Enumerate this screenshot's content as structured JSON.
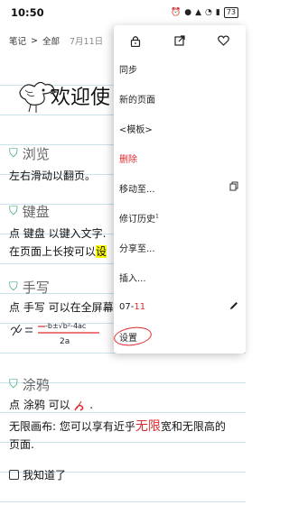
{
  "status": {
    "time": "10:50",
    "battery": "73"
  },
  "breadcrumb": {
    "notes": "笔记",
    "sep": ">",
    "all": "全部",
    "date": "7月11日"
  },
  "welcome": "欢迎使",
  "sections": {
    "browse": {
      "heading": "浏览",
      "line1": "左右滑动以翻页。"
    },
    "keyboard": {
      "heading": "键盘",
      "line1": "点 键盘 以键入文字.",
      "line2_a": "在页面上长按可以",
      "line2_hl": "设"
    },
    "handwriting": {
      "heading": "手写",
      "line1": "点 手写 可以在全屏幕"
    },
    "doodle": {
      "heading": "涂鸦",
      "line1_a": "点 涂鸦 可以",
      "line1_b": ".",
      "line2_a": "无限画布: 您可以享有近乎",
      "line2_red": "无限",
      "line2_b": "宽和无限高的",
      "line3": "页面."
    }
  },
  "checkbox_label": "我知道了",
  "menu": {
    "items": [
      {
        "label": "同步"
      },
      {
        "label": "新的页面"
      },
      {
        "label": "<模板>"
      },
      {
        "label": "删除"
      },
      {
        "label": "移动至..."
      },
      {
        "label": "修订历史",
        "sup": "1"
      },
      {
        "label": "分享至..."
      },
      {
        "label": "插入..."
      },
      {
        "label_a": "07-",
        "label_b": "11"
      },
      {
        "label": "设置"
      }
    ]
  }
}
